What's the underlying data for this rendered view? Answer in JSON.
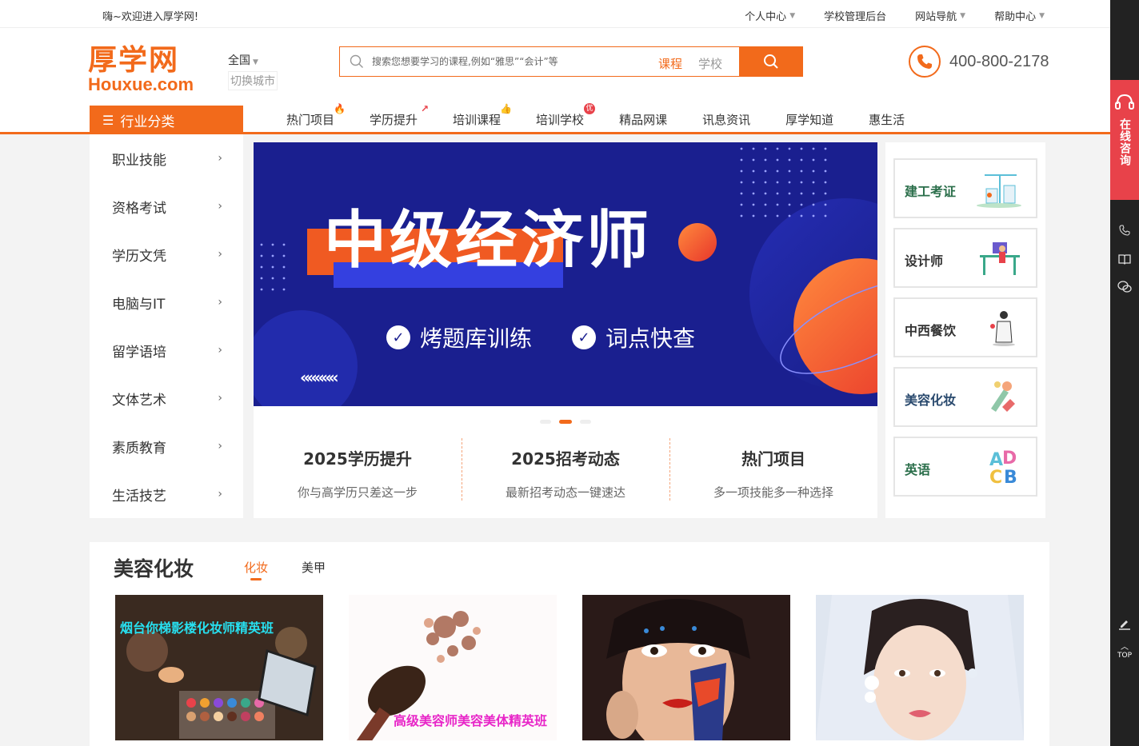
{
  "topbar": {
    "welcome": "嗨~欢迎进入厚学网!",
    "links": [
      "个人中心",
      "学校管理后台",
      "网站导航",
      "帮助中心"
    ]
  },
  "header": {
    "logo_cn": "厚学网",
    "logo_en": "Houxue.com",
    "city": "全国",
    "switch_city": "切换城市",
    "search_placeholder": "搜索您想要学习的课程,例如“雅思”“会计”等",
    "search_type_course": "课程",
    "search_type_school": "学校",
    "phone": "400-800-2178"
  },
  "nav": {
    "category_label": "行业分类",
    "items": [
      "热门项目",
      "学历提升",
      "培训课程",
      "培训学校",
      "精品网课",
      "讯息资讯",
      "厚学知道",
      "惠生活"
    ]
  },
  "sidebar": {
    "items": [
      "职业技能",
      "资格考试",
      "学历文凭",
      "电脑与IT",
      "留学语培",
      "文体艺术",
      "素质教育",
      "生活技艺"
    ]
  },
  "banner": {
    "title": "中级经济师",
    "feature1": "烤题库训练",
    "feature2": "词点快查",
    "arrows": "«««««"
  },
  "promos": [
    {
      "title": "2025学历提升",
      "sub": "你与高学历只差这一步"
    },
    {
      "title": "2025招考动态",
      "sub": "最新招考动态一键速达"
    },
    {
      "title": "热门项目",
      "sub": "多一项技能多一种选择"
    }
  ],
  "right_cards": [
    {
      "label": "建工考证",
      "color": "#2a6e4a"
    },
    {
      "label": "设计师",
      "color": "#333333"
    },
    {
      "label": "中西餐饮",
      "color": "#333333"
    },
    {
      "label": "美容化妆",
      "color": "#2a4a6e"
    },
    {
      "label": "英语",
      "color": "#2a6e4a"
    }
  ],
  "floatbar": {
    "online": "在线咨询",
    "top": "TOP"
  },
  "section": {
    "title": "美容化妆",
    "tabs": [
      "化妆",
      "美甲"
    ],
    "thumbs": [
      {
        "caption": "烟台你梯影楼化妆师精英班"
      },
      {
        "caption": "高级美容师美容美体精英班"
      },
      {
        "caption": ""
      },
      {
        "caption": ""
      }
    ]
  },
  "colors": {
    "brand": "#f26a1b",
    "banner_bg": "#1a1f8f",
    "online_red": "#e8424a"
  }
}
